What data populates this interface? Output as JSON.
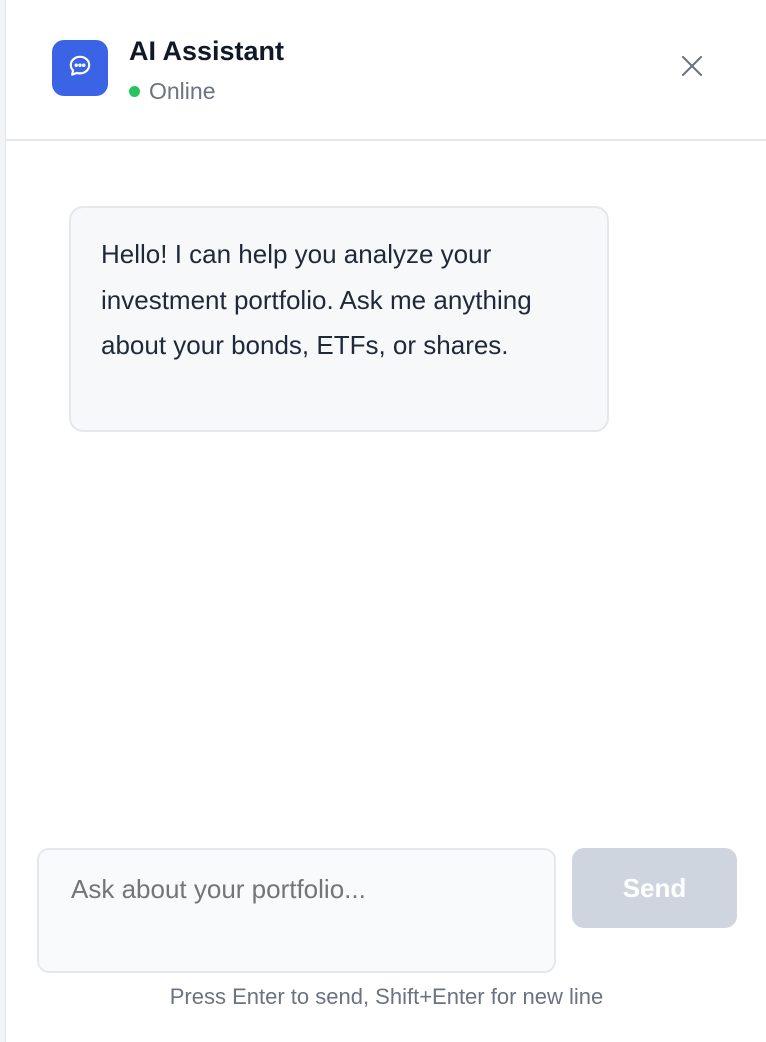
{
  "header": {
    "title": "AI Assistant",
    "status": "Online",
    "status_color": "#22c55e",
    "avatar_icon": "chat-bubble-icon",
    "close_icon": "close-icon"
  },
  "messages": [
    {
      "role": "assistant",
      "text": "Hello! I can help you analyze your investment portfolio. Ask me anything about your bonds, ETFs, or shares."
    }
  ],
  "composer": {
    "placeholder": "Ask about your portfolio...",
    "value": "",
    "send_label": "Send",
    "hint": "Press Enter to send, Shift+Enter for new line"
  },
  "colors": {
    "accent": "#3b63e5",
    "send_disabled": "#cfd5df"
  }
}
